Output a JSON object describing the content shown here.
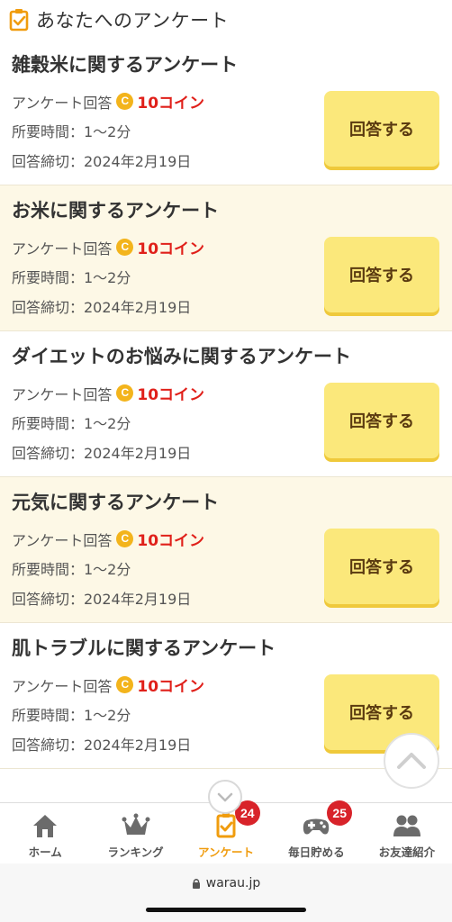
{
  "header": {
    "title": "あなたへのアンケート"
  },
  "surveys": [
    {
      "title": "雑穀米に関するアンケート",
      "reward_prefix": "アンケート回答",
      "coin_symbol": "C",
      "reward": "10コイン",
      "time": "所要時間：1〜2分",
      "deadline": "回答締切：2024年2月19日",
      "button": "回答する"
    },
    {
      "title": "お米に関するアンケート",
      "reward_prefix": "アンケート回答",
      "coin_symbol": "C",
      "reward": "10コイン",
      "time": "所要時間：1〜2分",
      "deadline": "回答締切：2024年2月19日",
      "button": "回答する"
    },
    {
      "title": "ダイエットのお悩みに関するアンケート",
      "reward_prefix": "アンケート回答",
      "coin_symbol": "C",
      "reward": "10コイン",
      "time": "所要時間：1〜2分",
      "deadline": "回答締切：2024年2月19日",
      "button": "回答する"
    },
    {
      "title": "元気に関するアンケート",
      "reward_prefix": "アンケート回答",
      "coin_symbol": "C",
      "reward": "10コイン",
      "time": "所要時間：1〜2分",
      "deadline": "回答締切：2024年2月19日",
      "button": "回答する"
    },
    {
      "title": "肌トラブルに関するアンケート",
      "reward_prefix": "アンケート回答",
      "coin_symbol": "C",
      "reward": "10コイン",
      "time": "所要時間：1〜2分",
      "deadline": "回答締切：2024年2月19日",
      "button": "回答する"
    }
  ],
  "tabs": [
    {
      "label": "ホーム",
      "icon": "home-icon"
    },
    {
      "label": "ランキング",
      "icon": "crown-icon"
    },
    {
      "label": "アンケート",
      "icon": "survey-icon",
      "active": true,
      "badge": "24"
    },
    {
      "label": "毎日貯める",
      "icon": "gamepad-icon",
      "badge": "25"
    },
    {
      "label": "お友達紹介",
      "icon": "friends-icon"
    }
  ],
  "browser": {
    "url": "warau.jp"
  },
  "colors": {
    "accent": "#f09c0e",
    "button": "#fbe87b",
    "reward": "#e0201a",
    "badge": "#d8232a",
    "alt_row": "#fdf8e6"
  }
}
